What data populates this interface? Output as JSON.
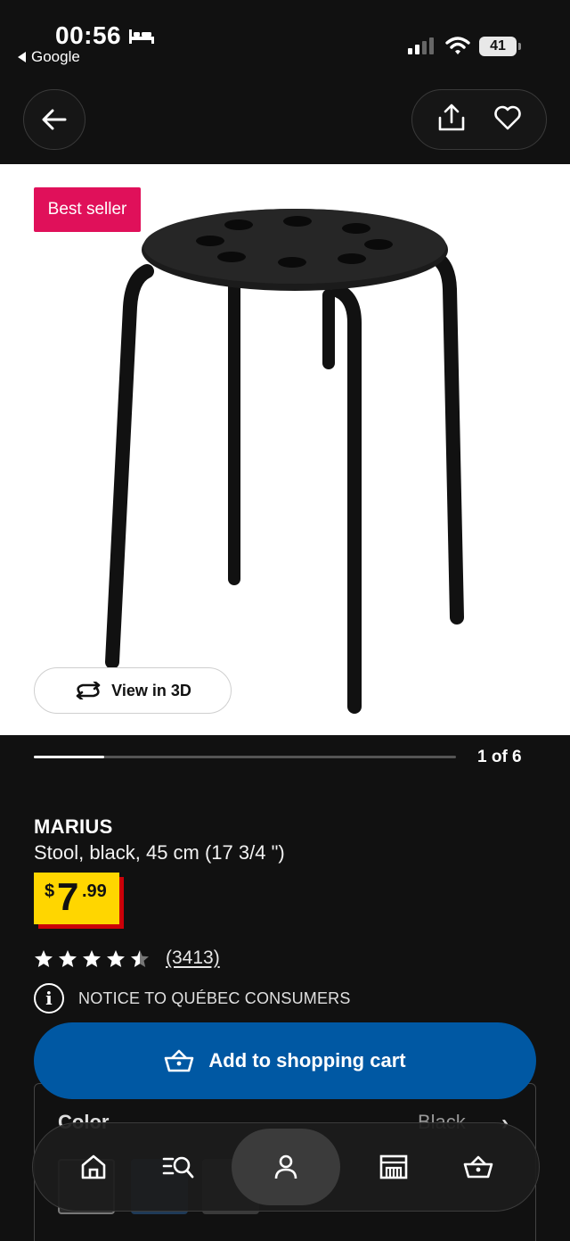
{
  "status_bar": {
    "time": "00:56",
    "back_app": "Google",
    "battery": "41",
    "icons": [
      "bed-icon",
      "signal-icon",
      "wifi-icon",
      "battery-icon"
    ]
  },
  "nav": {
    "icons": [
      "back-arrow-icon",
      "share-icon",
      "heart-icon"
    ]
  },
  "hero": {
    "badge": "Best seller",
    "view_3d_label": "View in 3D",
    "view_3d_icon": "rotate-icon"
  },
  "carousel": {
    "count_label": "1 of 6",
    "current": 1,
    "total": 6
  },
  "product": {
    "name": "MARIUS",
    "description": "Stool, black, 45 cm (17 3/4 \")",
    "price": {
      "currency": "$",
      "whole": "7",
      "cents": ".99"
    },
    "rating": {
      "value": 4.5,
      "max": 5,
      "count_label": "(3413)"
    },
    "notice": "NOTICE TO QUÉBEC CONSUMERS",
    "add_to_cart_label": "Add to shopping cart",
    "color_label": "Color",
    "color_value": "Black"
  },
  "tabbar": {
    "tabs": [
      {
        "name": "home",
        "icon": "home-icon",
        "active": false
      },
      {
        "name": "search",
        "icon": "search-icon",
        "active": false
      },
      {
        "name": "profile",
        "icon": "person-icon",
        "active": true
      },
      {
        "name": "store",
        "icon": "store-icon",
        "active": false
      },
      {
        "name": "cart",
        "icon": "basket-icon",
        "active": false
      }
    ]
  },
  "colors": {
    "background": "#111111",
    "badge": "#e0105a",
    "cart_button": "#0058a3",
    "price_yellow": "#ffd600",
    "price_red": "#cc0008"
  }
}
